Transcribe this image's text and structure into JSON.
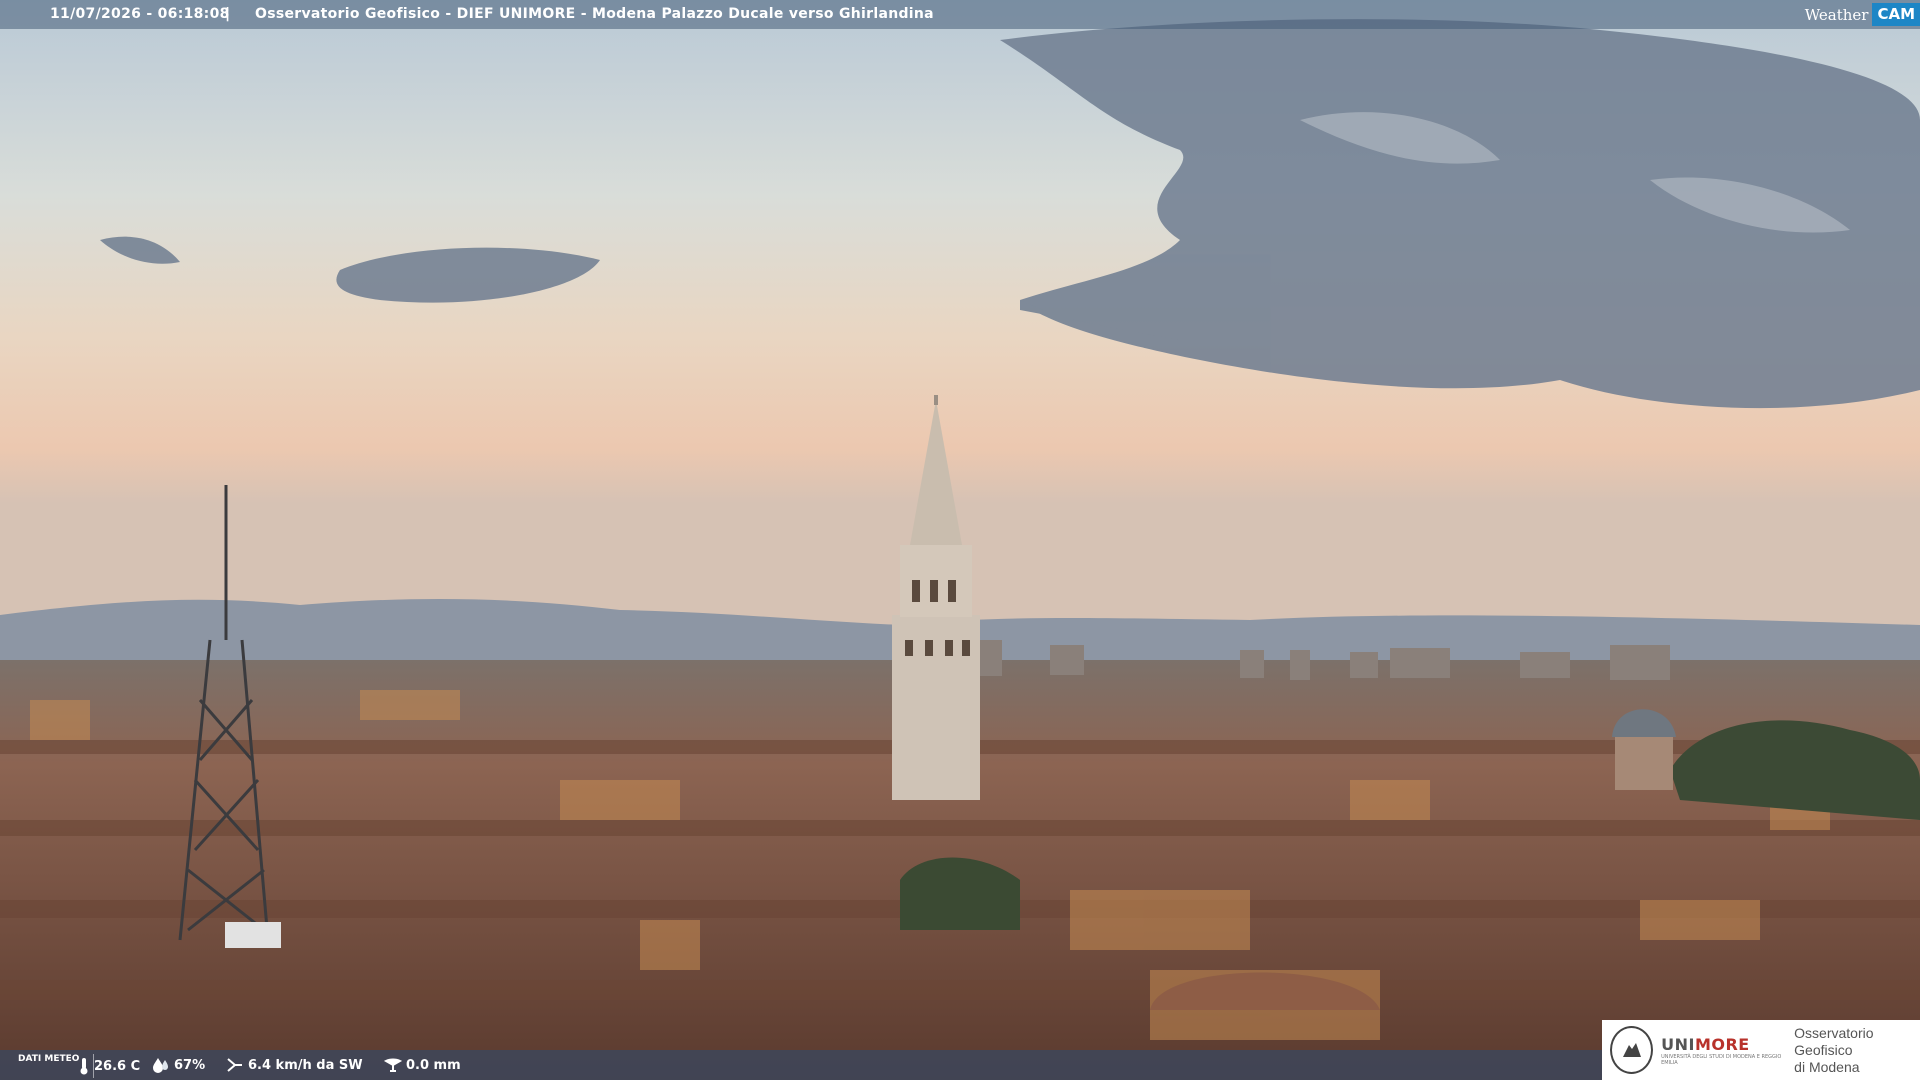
{
  "header": {
    "timestamp": "11/07/2026 - 06:18:08",
    "separator": "|",
    "title": "Osservatorio Geofisico - DIEF UNIMORE - Modena Palazzo Ducale verso Ghirlandina"
  },
  "logo": {
    "weather": "Weather",
    "cam": "CAM",
    "accent_color": "#1d86c6"
  },
  "weather": {
    "label": "DATI METEO",
    "temperature": "26.6 C",
    "humidity": "67%",
    "wind": "6.4 km/h da SW",
    "rain": "0.0 mm",
    "icons": [
      "thermometer-icon",
      "humidity-drop-icon",
      "wind-icon",
      "rain-gauge-icon"
    ]
  },
  "footer_logo": {
    "name_a": "UNI",
    "name_b": "MORE",
    "subtitle": "UNIVERSITÀ DEGLI STUDI DI MODENA E REGGIO EMILIA",
    "observatory_line1": "Osservatorio Geofisico",
    "observatory_line2": "di Modena",
    "brand_color": "#b8322b"
  }
}
